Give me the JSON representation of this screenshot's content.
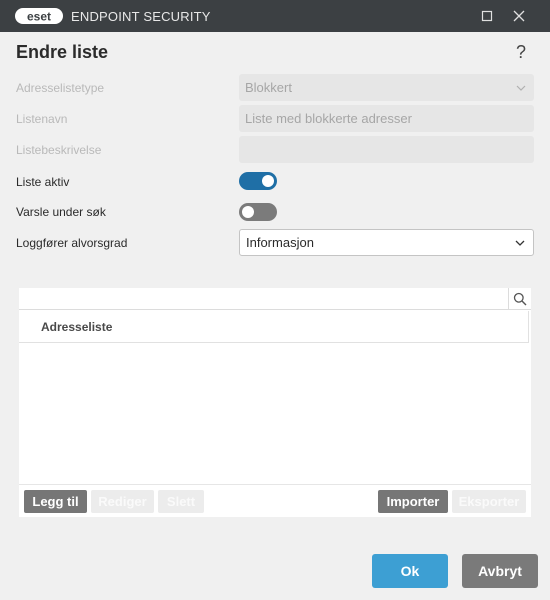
{
  "window": {
    "logo_text": "eset",
    "app_title": "ENDPOINT SECURITY"
  },
  "dialog": {
    "title": "Endre liste",
    "help": "?"
  },
  "form": {
    "list_type": {
      "label": "Adresselistetype",
      "value": "Blokkert"
    },
    "list_name": {
      "label": "Listenavn",
      "value": "Liste med blokkerte adresser"
    },
    "list_description": {
      "label": "Listebeskrivelse",
      "value": ""
    },
    "list_active": {
      "label": "Liste aktiv",
      "on": true
    },
    "notify_on_search": {
      "label": "Varsle under søk",
      "on": false
    },
    "log_severity": {
      "label": "Loggfører alvorsgrad",
      "value": "Informasjon"
    }
  },
  "list_panel": {
    "search_placeholder": "",
    "column_header": "Adresseliste",
    "rows": [],
    "buttons": {
      "add": "Legg til",
      "edit": "Rediger",
      "delete": "Slett",
      "import": "Importer",
      "export": "Eksporter"
    }
  },
  "footer": {
    "ok": "Ok",
    "cancel": "Avbryt"
  },
  "colors": {
    "accent": "#3d9fd3",
    "toggle_on": "#1f6fa6",
    "titlebar": "#3c4043"
  },
  "icons": {
    "maximize": "maximize-icon",
    "close": "close-icon",
    "search": "search-icon",
    "dropdown": "chevron-down-icon"
  }
}
